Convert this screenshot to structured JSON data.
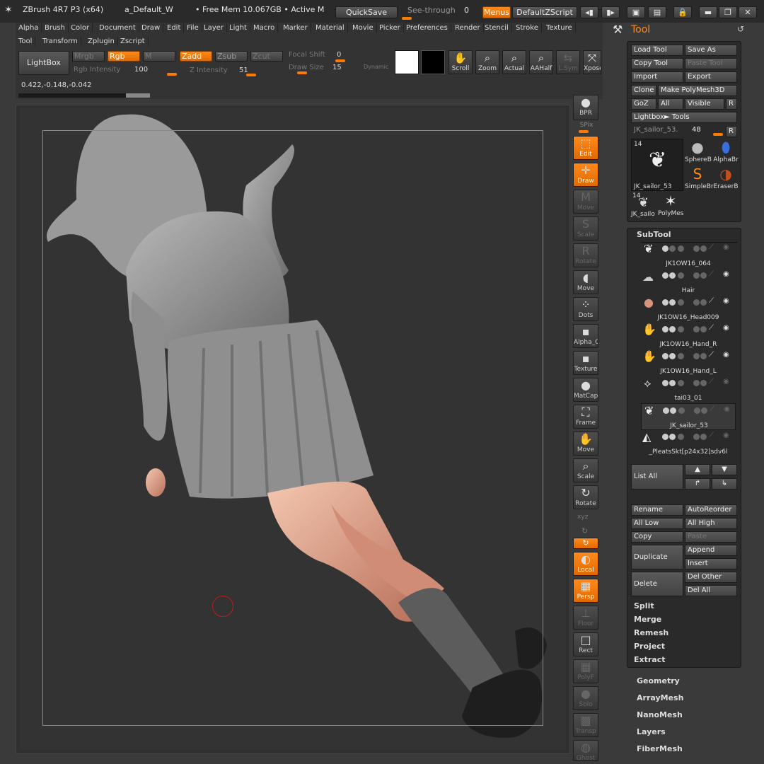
{
  "titlebar": {
    "app": "ZBrush 4R7 P3 (x64)",
    "doc": "a_Default_W",
    "mem": "• Free Mem 10.067GB • Active M",
    "quicksave": "QuickSave",
    "seethrough_label": "See-through",
    "seethrough_value": "0",
    "menus": "Menus",
    "script": "DefaultZScript"
  },
  "menubar": {
    "row1": [
      "Alpha",
      "Brush",
      "Color",
      "Document",
      "Draw",
      "Edit",
      "File",
      "Layer",
      "Light",
      "Macro",
      "Marker",
      "Material",
      "Movie",
      "Picker",
      "Preferences",
      "Render",
      "Stencil",
      "Stroke",
      "Texture"
    ],
    "row2": [
      "Tool",
      "Transform",
      "Zplugin",
      "Zscript"
    ]
  },
  "toolbar": {
    "lightbox": "LightBox",
    "mrgb": "Mrgb",
    "rgb": "Rgb",
    "m": "M",
    "zadd": "Zadd",
    "zsub": "Zsub",
    "zcut": "Zcut",
    "focal_label": "Focal Shift",
    "focal_value": "0",
    "rgb_int_label": "Rgb Intensity",
    "rgb_int_value": "100",
    "z_int_label": "Z Intensity",
    "z_int_value": "51",
    "draw_size_label": "Draw Size",
    "draw_size_value": "15",
    "dynamic": "Dynamic",
    "scroll": "Scroll",
    "zoom": "Zoom",
    "actual": "Actual",
    "aahalf": "AAHalf",
    "lsym": "L.Sym",
    "xpose": "Xpose",
    "coords": "0.422,-0.148,-0.042"
  },
  "righttools": [
    "BPR",
    "SPix",
    "Edit",
    "Draw",
    "Move",
    "Scale",
    "Rotate",
    "Move",
    "Dots",
    "Alpha_C",
    "Texture",
    "MatCap",
    "Frame",
    "Move",
    "Scale",
    "Rotate",
    "Local",
    "Persp",
    "Floor",
    "Rect",
    "PolyF",
    "Solo",
    "Transp",
    "Ghost"
  ],
  "tool": {
    "title": "Tool",
    "load": "Load Tool",
    "save": "Save As",
    "copy": "Copy Tool",
    "paste": "Paste Tool",
    "import": "Import",
    "export": "Export",
    "clone": "Clone",
    "make": "Make PolyMesh3D",
    "goz": "GoZ",
    "all": "All",
    "visible": "Visible",
    "r": "R",
    "lightbox_tools": "Lightbox► Tools",
    "current_name": "JK_sailor_53.",
    "current_value": "48",
    "thumb_count": "14",
    "thumbs": [
      "JK_sailor_53",
      "SphereB",
      "AlphaBr",
      "SimpleBr",
      "EraserB",
      "JK_sailo",
      "PolyMes"
    ],
    "thumb_count2": "14"
  },
  "subtool": {
    "header": "SubTool",
    "items": [
      "JK1OW16_064",
      "Hair",
      "JK1OW16_Head009",
      "JK1OW16_Hand_R",
      "JK1OW16_Hand_L",
      "tai03_01",
      "JK_sailor_53",
      "_PleatsSkt[p24x32]sdv6l"
    ],
    "list_all": "List All",
    "rename": "Rename",
    "autoreorder": "AutoReorder",
    "all_low": "All Low",
    "all_high": "All High",
    "copy": "Copy",
    "paste": "Paste",
    "duplicate": "Duplicate",
    "append": "Append",
    "insert": "Insert",
    "delete": "Delete",
    "del_other": "Del Other",
    "del_all": "Del All",
    "sections": [
      "Split",
      "Merge",
      "Remesh",
      "Project",
      "Extract"
    ]
  },
  "more": [
    "Geometry",
    "ArrayMesh",
    "NanoMesh",
    "Layers",
    "FiberMesh"
  ]
}
